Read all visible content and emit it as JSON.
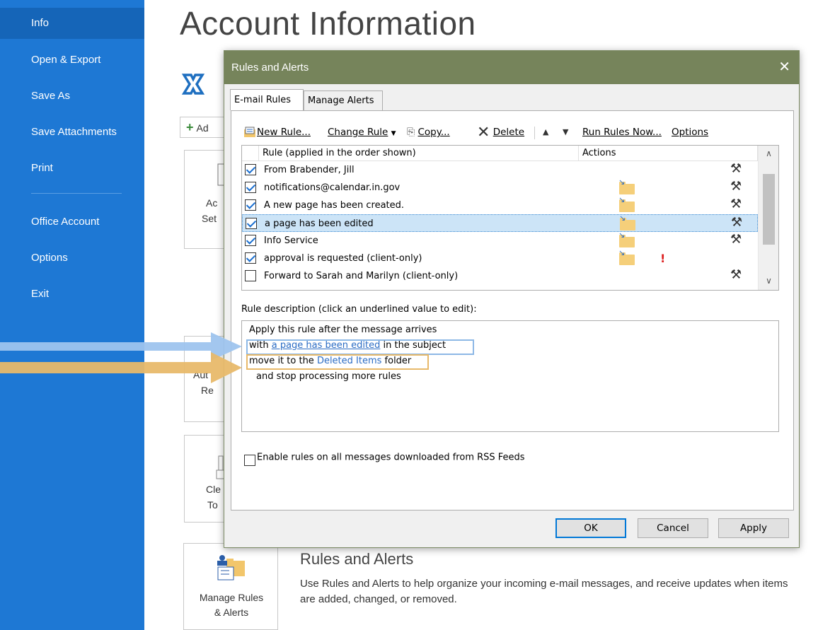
{
  "sidebar": {
    "items": [
      {
        "label": "Info",
        "active": true
      },
      {
        "label": "Open & Export"
      },
      {
        "label": "Save As"
      },
      {
        "label": "Save Attachments"
      },
      {
        "label": "Print"
      },
      {
        "label": "Office Account"
      },
      {
        "label": "Options"
      },
      {
        "label": "Exit"
      }
    ]
  },
  "main": {
    "title": "Account Information",
    "add_account_label": "Ad",
    "tile_account_settings_line1": "Ac",
    "tile_account_settings_line2": "Set",
    "tile_auto_reply_line1": "Aut",
    "tile_auto_reply_line2": "Re",
    "tile_cleanup_line1": "Cle",
    "tile_cleanup_line2": "To",
    "manage_rules_label_line1": "Manage Rules",
    "manage_rules_label_line2": "& Alerts",
    "rules_heading": "Rules and Alerts",
    "rules_description": "Use Rules and Alerts to help organize your incoming e-mail messages, and receive updates when items are added, changed, or removed."
  },
  "dialog": {
    "title": "Rules and Alerts",
    "close_glyph": "✕",
    "tabs": [
      {
        "label": "E-mail Rules",
        "active": true
      },
      {
        "label": "Manage Alerts"
      }
    ],
    "toolbar": {
      "new_rule": "New Rule...",
      "change_rule": "Change Rule",
      "copy": "Copy...",
      "delete": "Delete",
      "run_rules_now": "Run Rules Now...",
      "options": "Options"
    },
    "columns": {
      "rule": "Rule (applied in the order shown)",
      "actions": "Actions"
    },
    "rules": [
      {
        "label": "From Brabender, Jill",
        "checked": true,
        "folder": false,
        "flag": false,
        "selected": false
      },
      {
        "label": "notifications@calendar.in.gov",
        "checked": true,
        "folder": true,
        "flag": false,
        "selected": false
      },
      {
        "label": "A new page has been created.",
        "checked": true,
        "folder": true,
        "flag": false,
        "selected": false
      },
      {
        "label": "a page has been edited",
        "checked": true,
        "folder": true,
        "flag": false,
        "selected": true
      },
      {
        "label": "Info Service",
        "checked": true,
        "folder": true,
        "flag": false,
        "selected": false
      },
      {
        "label": "approval is requested  (client-only)",
        "checked": true,
        "folder": true,
        "flag": true,
        "selected": false
      },
      {
        "label": "Forward to Sarah and Marilyn  (client-only)",
        "checked": false,
        "folder": false,
        "flag": false,
        "selected": false
      }
    ],
    "description_label": "Rule description (click an underlined value to edit):",
    "description": {
      "line1": "Apply this rule after the message arrives",
      "line2_prefix": "with ",
      "line2_link": "a page has been edited",
      "line2_suffix": " in the subject",
      "line3_prefix": "move it to the ",
      "line3_link": "Deleted Items",
      "line3_suffix": " folder",
      "line4": "and stop processing more rules"
    },
    "rss_label": "Enable rules on all messages downloaded from RSS Feeds",
    "buttons": {
      "ok": "OK",
      "cancel": "Cancel",
      "apply": "Apply"
    }
  },
  "colors": {
    "sidebar": "#1e78d4",
    "dialog_title": "#76845b",
    "link": "#2b6cc4",
    "highlight_blue": "#8db8e6",
    "highlight_orange": "#e8b96a"
  }
}
